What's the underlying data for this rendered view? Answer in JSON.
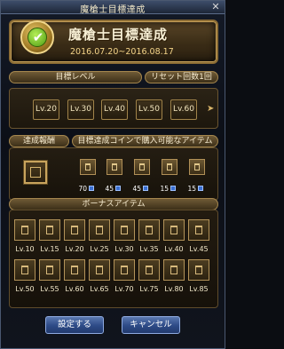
{
  "window": {
    "title": "魔槍士目標達成"
  },
  "banner": {
    "title": "魔槍士目標達成",
    "period": "2016.07.20~2016.08.17"
  },
  "target_level": {
    "label": "目標レベル",
    "reset_label": "リセット回数1回",
    "levels": [
      "Lv.20",
      "Lv.30",
      "Lv.40",
      "Lv.50",
      "Lv.60"
    ]
  },
  "rewards": {
    "label": "達成報酬",
    "coin_label": "目標達成コインで購入可能なアイテム",
    "items": [
      {
        "qty": "70"
      },
      {
        "qty": "45"
      },
      {
        "qty": "45"
      },
      {
        "qty": "15"
      },
      {
        "qty": "15"
      }
    ]
  },
  "bonus": {
    "label": "ボーナスアイテム",
    "levels": [
      "Lv.10",
      "Lv.15",
      "Lv.20",
      "Lv.25",
      "Lv.30",
      "Lv.35",
      "Lv.40",
      "Lv.45",
      "Lv.50",
      "Lv.55",
      "Lv.60",
      "Lv.65",
      "Lv.70",
      "Lv.75",
      "Lv.80",
      "Lv.85"
    ]
  },
  "buttons": {
    "confirm": "設定する",
    "cancel": "キャンセル"
  },
  "icons": {
    "close": "close-icon",
    "check": "check-icon",
    "arrow": "arrow-right-icon"
  }
}
